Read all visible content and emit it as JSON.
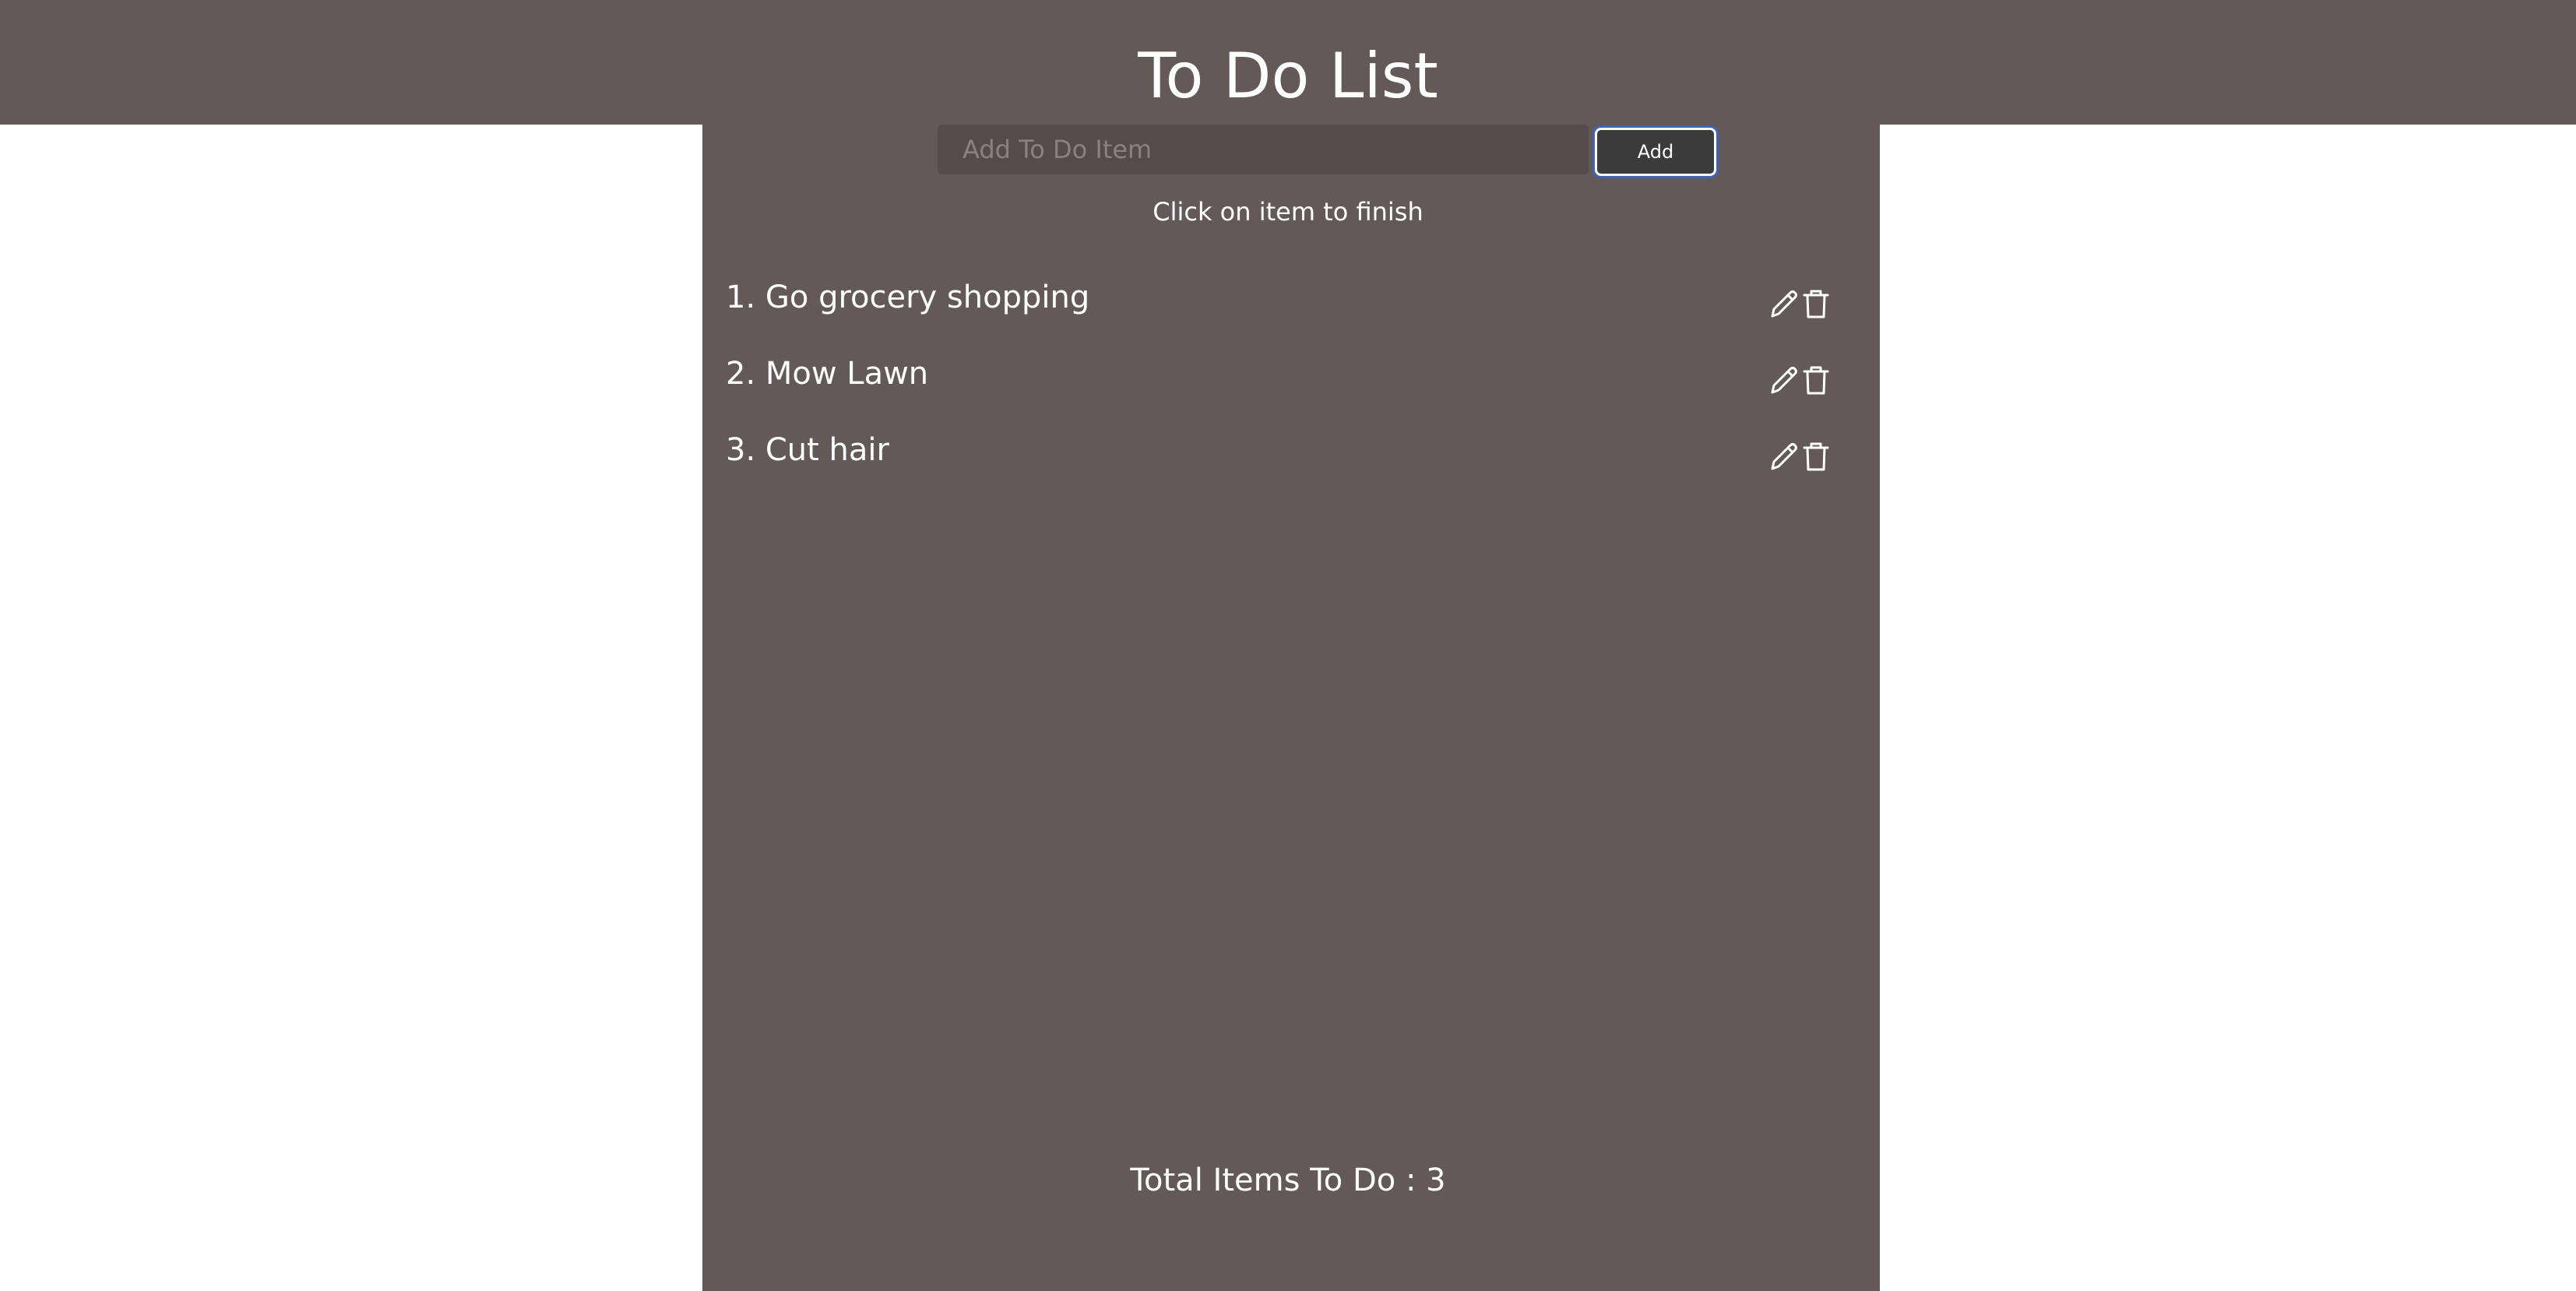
{
  "header": {
    "title": "To Do List"
  },
  "form": {
    "placeholder": "Add To Do Item",
    "value": "",
    "add_label": "Add"
  },
  "hint": "Click on item to finish",
  "items": [
    {
      "label": "1. Go grocery shopping"
    },
    {
      "label": "2. Mow Lawn"
    },
    {
      "label": "3. Cut hair"
    }
  ],
  "footer": {
    "total": "Total Items To Do : 3"
  },
  "icons": {
    "edit": "pencil-icon",
    "delete": "trash-icon"
  },
  "colors": {
    "background": "#635959",
    "input_background": "#544c4c",
    "button_background": "#3b3b3b",
    "focus_ring": "#3e63b8",
    "text": "#ffffff"
  }
}
